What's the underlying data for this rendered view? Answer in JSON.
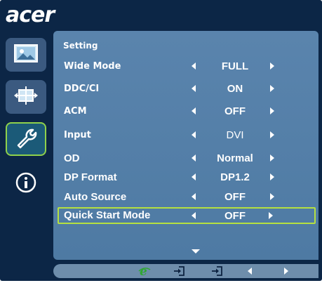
{
  "brand": {
    "logo_text": "acer"
  },
  "sidebar": {
    "items": [
      {
        "icon": "picture-icon"
      },
      {
        "icon": "position-icon"
      },
      {
        "icon": "wrench-icon",
        "active": true
      },
      {
        "icon": "info-icon"
      }
    ]
  },
  "menu": {
    "title": "Setting",
    "rows": [
      {
        "label": "Wide Mode",
        "value": "FULL"
      },
      {
        "label": "DDC/CI",
        "value": "ON"
      },
      {
        "label": "ACM",
        "value": "OFF"
      },
      {
        "label": "Input",
        "value": "DVI"
      },
      {
        "label": "OD",
        "value": "Normal"
      },
      {
        "label": "DP Format",
        "value": "DP1.2"
      },
      {
        "label": "Auto Source",
        "value": "OFF"
      },
      {
        "label": "Quick Start Mode",
        "value": "OFF",
        "selected": true
      }
    ],
    "more_indicator": "chevron-down-icon"
  },
  "bottombar": {
    "items": [
      "e-key-icon",
      "exit-icon",
      "enter-icon",
      "left-arrow-icon",
      "right-arrow-icon"
    ]
  },
  "colors": {
    "frame": "#0c2646",
    "panel": "#5a84ad",
    "highlight": "#b5e040",
    "active_border": "#8fd14b"
  }
}
